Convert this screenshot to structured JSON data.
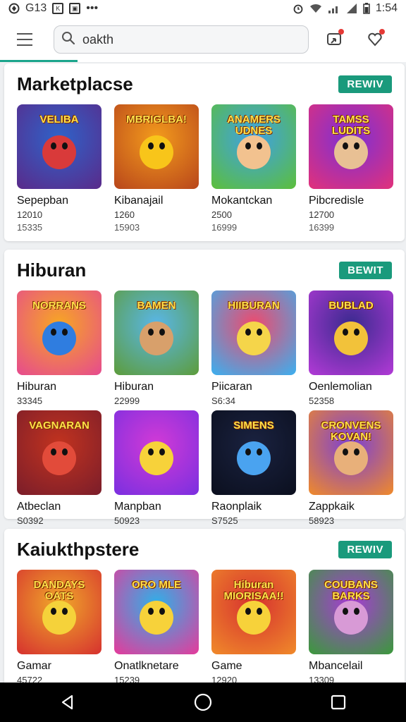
{
  "status_bar": {
    "left_text": "G13",
    "right_text": "1:54",
    "dots": "•••"
  },
  "search": {
    "value": "oakth",
    "placeholder": ""
  },
  "sections": [
    {
      "title": "Marketplacse",
      "button": "REWIV",
      "tiles": [
        {
          "name": "Sepepban",
          "n1": "12010",
          "n2": "15335",
          "art": "VELIBA",
          "bg1": "#2e63c9",
          "bg2": "#5a2a8a",
          "fg": "#d93a3a"
        },
        {
          "name": "Kibanajail",
          "n1": "1260",
          "n2": "15903",
          "art": "MBRIGLBA!",
          "bg1": "#f39b1c",
          "bg2": "#b8461b",
          "fg": "#f8c51a"
        },
        {
          "name": "Mokantckan",
          "n1": "2500",
          "n2": "16999",
          "art": "ANAMERS UDNES",
          "bg1": "#3ea0e8",
          "bg2": "#5cbf3a",
          "fg": "#f2c28f"
        },
        {
          "name": "Pibcredisle",
          "n1": "12700",
          "n2": "16399",
          "art": "TAMSS LUDITS",
          "bg1": "#7b2fd6",
          "bg2": "#e2317a",
          "fg": "#e8c094"
        }
      ]
    },
    {
      "title": "Hiburan",
      "button": "BEWIT",
      "tiles": [
        {
          "name": "Hiburan",
          "n1": "33345",
          "n2": "",
          "art": "NORRANS",
          "bg1": "#f7a623",
          "bg2": "#e64a8f",
          "fg": "#2f7de0"
        },
        {
          "name": "Hiburan",
          "n1": "22999",
          "n2": "",
          "art": "BAMEN",
          "bg1": "#59b6e8",
          "bg2": "#5d9c3a",
          "fg": "#d8a06b"
        },
        {
          "name": "Piicaran",
          "n1": "S6:34",
          "n2": "",
          "art": "HIIBURAN",
          "bg1": "#ef4a6d",
          "bg2": "#3ab0f0",
          "fg": "#f5d54a"
        },
        {
          "name": "Oenlemolian",
          "n1": "52358",
          "n2": "",
          "art": "BUBLAD",
          "bg1": "#3a2a8f",
          "bg2": "#b23ad6",
          "fg": "#f2c23a"
        },
        {
          "name": "Atbeclan",
          "n1": "S0392",
          "n2": "",
          "art": "VAGNARAN",
          "bg1": "#c2331f",
          "bg2": "#7a1d2a",
          "fg": "#e24b3a"
        },
        {
          "name": "Manpban",
          "n1": "50923",
          "n2": "",
          "art": "",
          "bg1": "#d23ad6",
          "bg2": "#7a2fe0",
          "fg": "#f7d23a"
        },
        {
          "name": "Raonplaik",
          "n1": "S7525",
          "n2": "",
          "art": "SIMENS",
          "bg1": "#1a2240",
          "bg2": "#0b0f1e",
          "fg": "#4aa3f0"
        },
        {
          "name": "Zappkaik",
          "n1": "58923",
          "n2": "",
          "art": "CRONVENS KOVAN!",
          "bg1": "#7a3fd6",
          "bg2": "#f08a2a",
          "fg": "#e8b07a"
        }
      ]
    },
    {
      "title": "Kaiukthpstere",
      "button": "REWIV",
      "tiles": [
        {
          "name": "Gamar",
          "n1": "45722",
          "n2": "",
          "art": "DANDAYS OATS",
          "bg1": "#f0a92a",
          "bg2": "#d6312f",
          "fg": "#f5d23a"
        },
        {
          "name": "Onatlknetare",
          "n1": "15239",
          "n2": "",
          "art": "ORO MLE",
          "bg1": "#2fb0e8",
          "bg2": "#e63a9a",
          "fg": "#f7d23a"
        },
        {
          "name": "Game",
          "n1": "12920",
          "n2": "",
          "art": "Hiburan MIORISAA!!",
          "bg1": "#d6312f",
          "bg2": "#f08a2a",
          "fg": "#f7d23a"
        },
        {
          "name": "Mbancelail",
          "n1": "13309",
          "n2": "",
          "art": "COUBANS BARKS",
          "bg1": "#a83ad6",
          "bg2": "#3a9a3a",
          "fg": "#d89ad6"
        }
      ]
    }
  ],
  "colors": {
    "accent": "#1a9a7c",
    "notification": "#e53935"
  }
}
